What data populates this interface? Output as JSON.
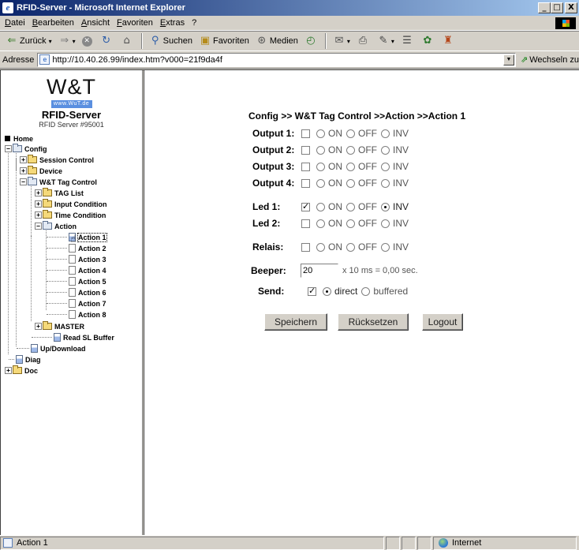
{
  "window": {
    "title": "RFID-Server - Microsoft Internet Explorer",
    "buttons": {
      "minimize": "_",
      "maximize": "□",
      "close": "X"
    }
  },
  "menu": [
    "Datei",
    "Bearbeiten",
    "Ansicht",
    "Favoriten",
    "Extras",
    "?"
  ],
  "toolbar": {
    "back": "Zurück",
    "search": "Suchen",
    "favorites": "Favoriten",
    "media": "Medien"
  },
  "address": {
    "label": "Adresse",
    "url": "http://10.40.26.99/index.htm?v000=21f9da4f",
    "go": "Wechseln zu"
  },
  "logo": {
    "brand": "W&T",
    "site": "www.WuT.de",
    "product": "RFID-Server",
    "model": "RFID Server #95001"
  },
  "tree": {
    "home": "Home",
    "config": "Config",
    "session_control": "Session Control",
    "device": "Device",
    "wt_tag_control": "W&T Tag Control",
    "tag_list": "TAG List",
    "input_condition": "Input Condition",
    "time_condition": "Time Condition",
    "action": "Action",
    "actions": [
      "Action 1",
      "Action 2",
      "Action 3",
      "Action 4",
      "Action 5",
      "Action 6",
      "Action 7",
      "Action 8"
    ],
    "master": "MASTER",
    "read_sl_buffer": "Read SL Buffer",
    "up_download": "Up/Download",
    "diag": "Diag",
    "doc": "Doc"
  },
  "form": {
    "title": "Config >> W&T Tag Control >>Action  >>Action 1",
    "state_labels": {
      "on": "ON",
      "off": "OFF",
      "inv": "INV"
    },
    "rows": [
      {
        "label": "Output 1:",
        "checked": false,
        "selected": null
      },
      {
        "label": "Output 2:",
        "checked": false,
        "selected": null
      },
      {
        "label": "Output 3:",
        "checked": false,
        "selected": null
      },
      {
        "label": "Output 4:",
        "checked": false,
        "selected": null
      },
      {
        "label": "Led 1:",
        "checked": true,
        "selected": "inv"
      },
      {
        "label": "Led 2:",
        "checked": false,
        "selected": null
      },
      {
        "label": "Relais:",
        "checked": false,
        "selected": null
      }
    ],
    "beeper": {
      "label": "Beeper:",
      "value": "20",
      "unit": "x 10 ms = 0,00 sec."
    },
    "send": {
      "label": "Send:",
      "checked": true,
      "direct": "direct",
      "buffered": "buffered",
      "selected": "direct"
    },
    "buttons": {
      "save": "Speichern",
      "reset": "Rücksetzen",
      "logout": "Logout"
    }
  },
  "status": {
    "text": "Action 1",
    "zone": "Internet"
  }
}
